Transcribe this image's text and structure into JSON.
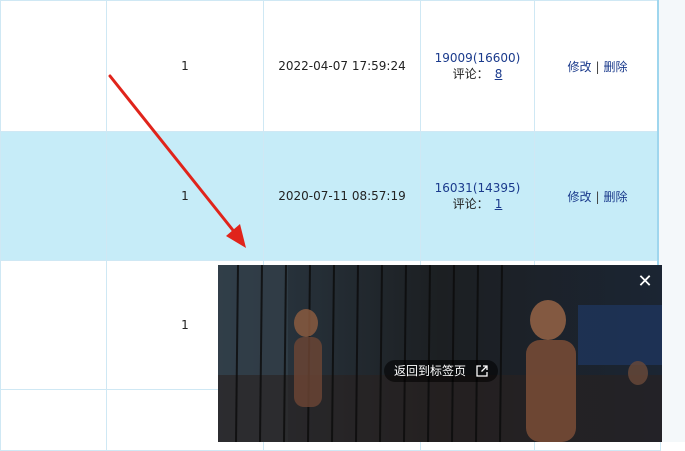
{
  "rows": [
    {
      "count": "1",
      "date": "2022-04-07 17:59:24",
      "views": "19009(16600)",
      "comment_label": "评论：",
      "comment_count": "8",
      "edit": "修改",
      "sep": "|",
      "delete": "删除"
    },
    {
      "count": "1",
      "date": "2020-07-11 08:57:19",
      "views": "16031(14395)",
      "comment_label": "评论：",
      "comment_count": "1",
      "edit": "修改",
      "sep": "|",
      "delete": "删除"
    },
    {
      "count": "1"
    }
  ],
  "pip": {
    "return_label": "返回到标签页",
    "close_glyph": "✕",
    "icons": {
      "close": "close-icon",
      "external": "external-link-icon"
    }
  },
  "colors": {
    "row_highlight": "#c6ecf8",
    "link": "#1a3a8c",
    "annotation_arrow": "#e0241b"
  }
}
